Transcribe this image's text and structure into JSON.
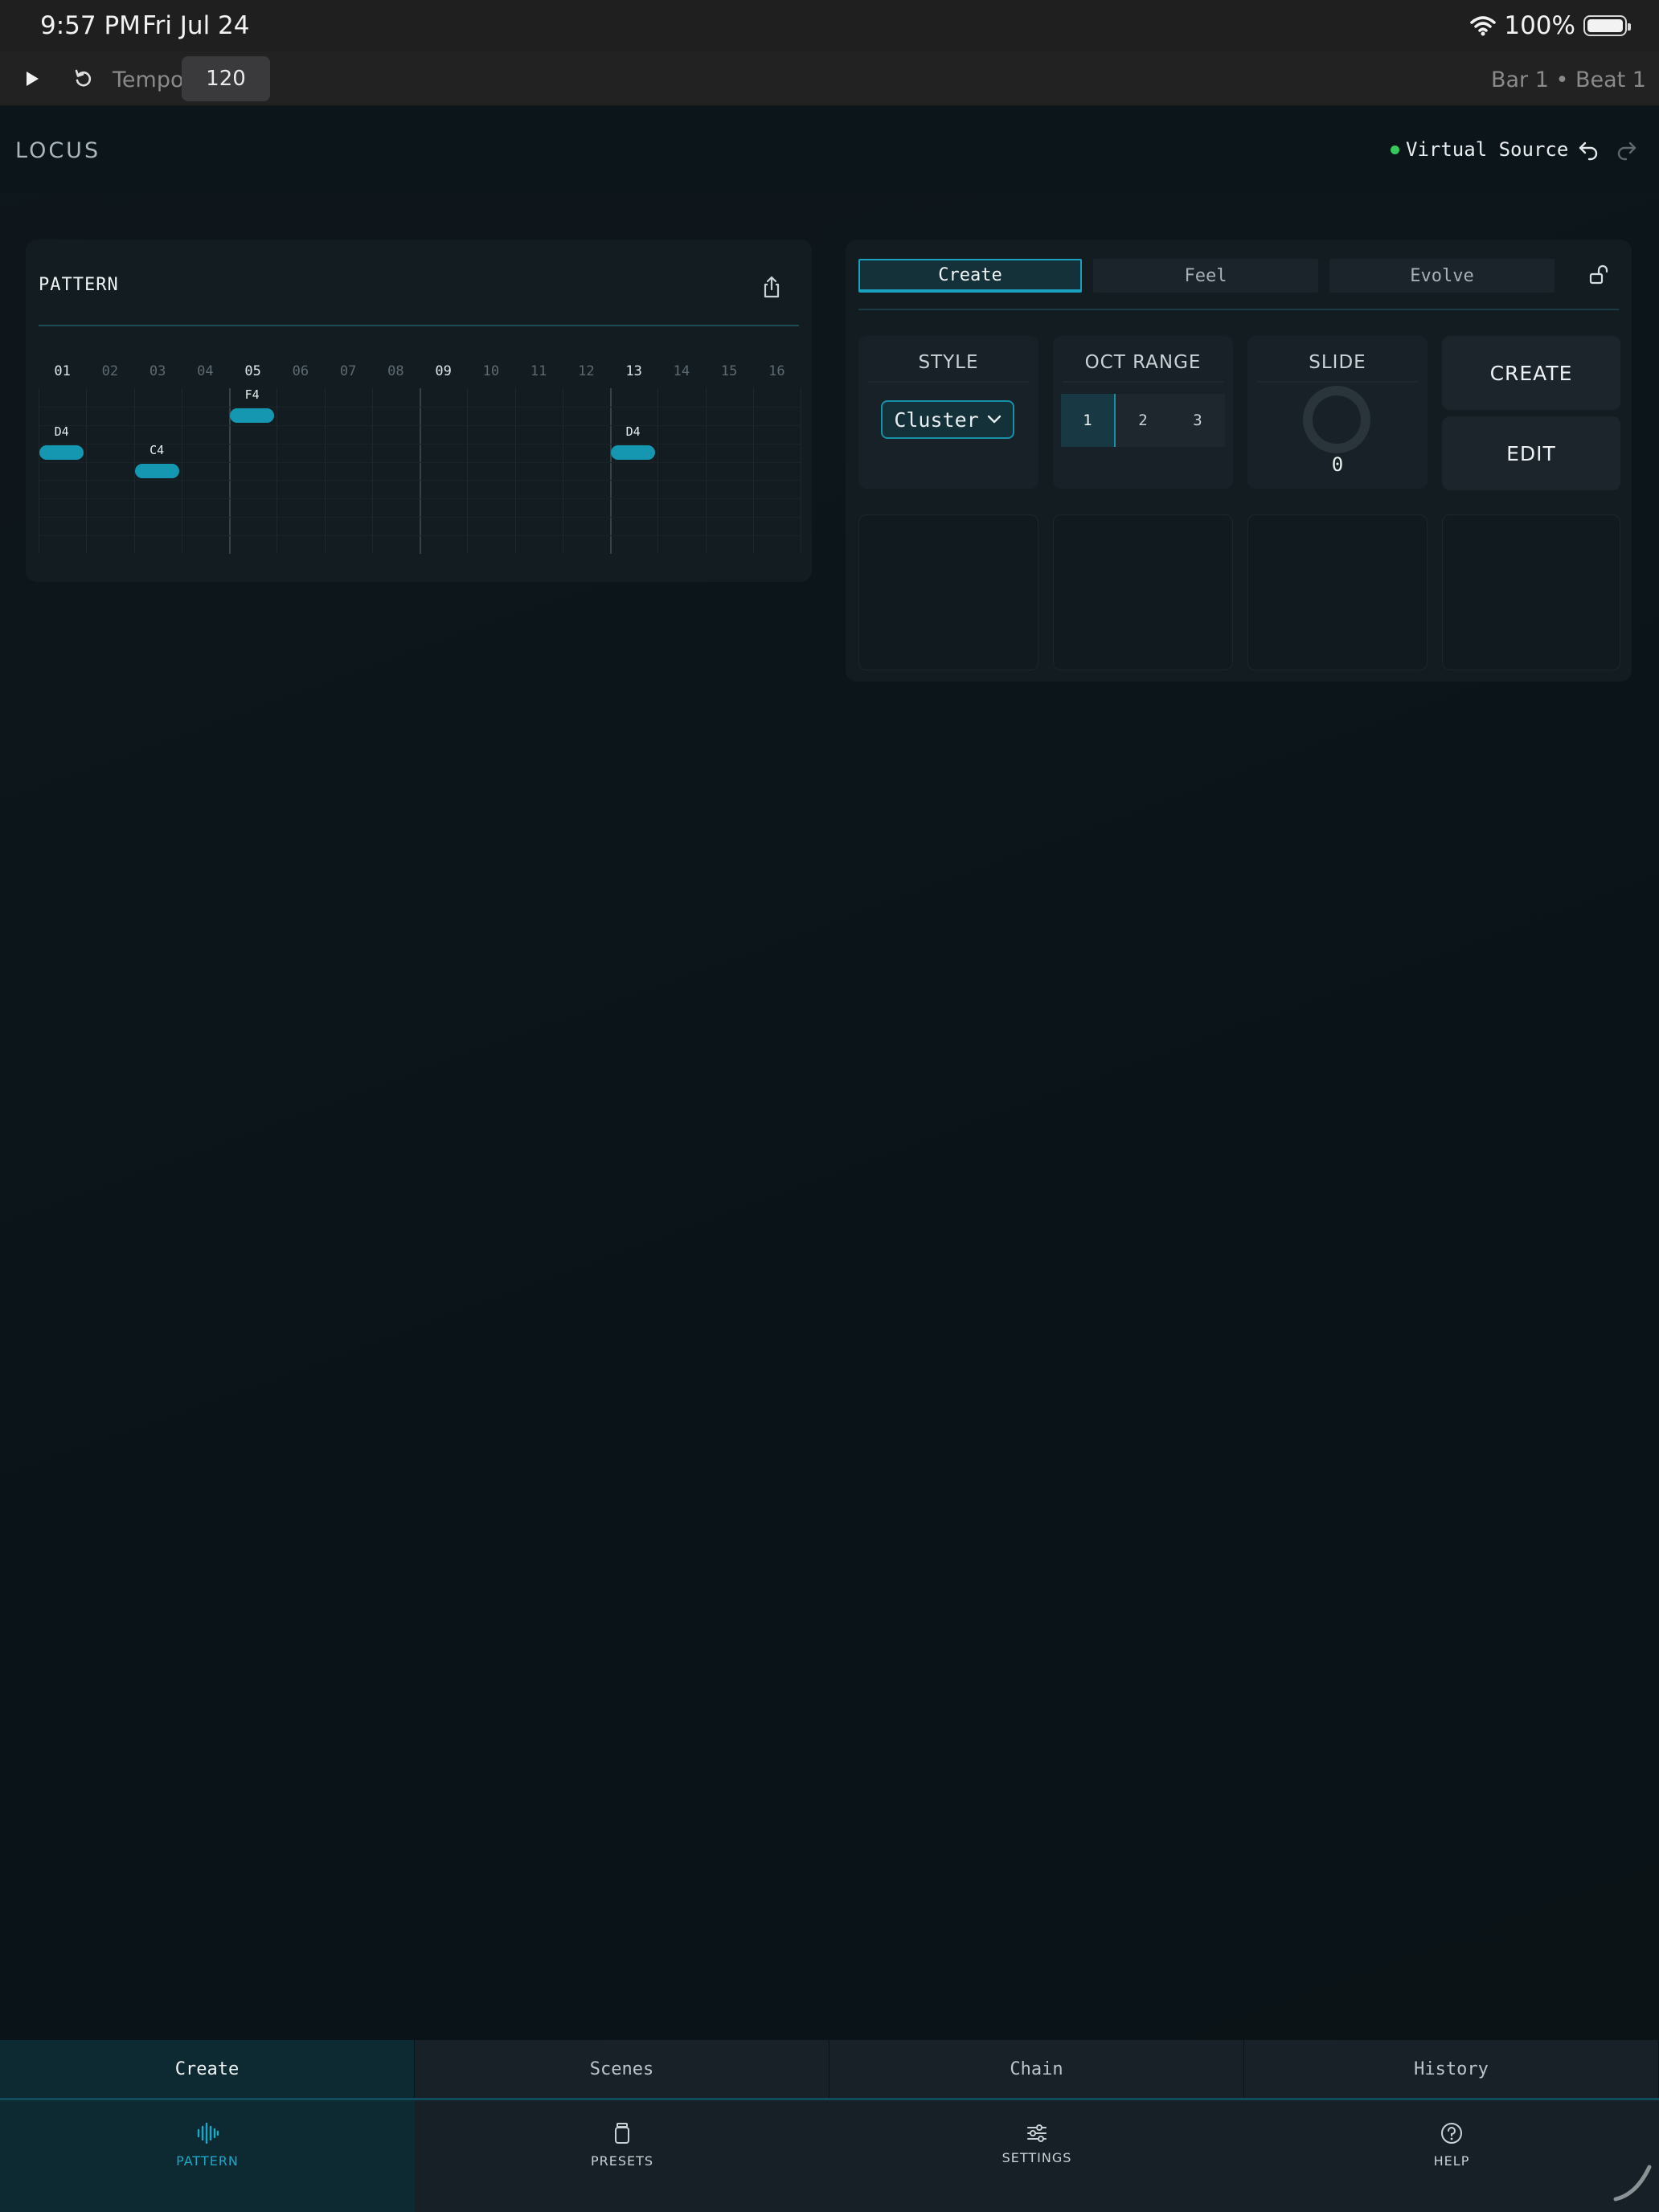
{
  "status_bar": {
    "time": "9:57 PM",
    "date": "Fri Jul 24",
    "battery": "100%"
  },
  "transport": {
    "tempo_label": "Tempo",
    "tempo_value": "120",
    "position": "Bar 1 • Beat 1"
  },
  "app": {
    "title": "LOCUS",
    "midi_source": "Virtual Source",
    "midi_status_color": "#35c85a"
  },
  "pattern": {
    "title": "PATTERN",
    "steps": [
      "01",
      "02",
      "03",
      "04",
      "05",
      "06",
      "07",
      "08",
      "09",
      "10",
      "11",
      "12",
      "13",
      "14",
      "15",
      "16"
    ],
    "notes": [
      {
        "label": "D4",
        "step": 1
      },
      {
        "label": "C4",
        "step": 3
      },
      {
        "label": "F4",
        "step": 5
      },
      {
        "label": "D4",
        "step": 13
      }
    ]
  },
  "controls": {
    "tabs": [
      {
        "label": "Create",
        "active": true
      },
      {
        "label": "Feel",
        "active": false
      },
      {
        "label": "Evolve",
        "active": false
      }
    ],
    "style": {
      "label": "STYLE",
      "value": "Cluster"
    },
    "oct_range": {
      "label": "OCT RANGE",
      "options": [
        "1",
        "2",
        "3"
      ],
      "selected": "1"
    },
    "slide": {
      "label": "SLIDE",
      "value": "0"
    },
    "create_label": "CREATE",
    "edit_label": "EDIT"
  },
  "sub_tabs": [
    {
      "label": "Create",
      "active": true
    },
    {
      "label": "Scenes",
      "active": false
    },
    {
      "label": "Chain",
      "active": false
    },
    {
      "label": "History",
      "active": false
    }
  ],
  "nav": [
    {
      "label": "PATTERN",
      "icon": "waveform-icon",
      "active": true
    },
    {
      "label": "PRESETS",
      "icon": "jar-icon",
      "active": false
    },
    {
      "label": "SETTINGS",
      "icon": "sliders-icon",
      "active": false
    },
    {
      "label": "HELP",
      "icon": "question-circle-icon",
      "active": false
    }
  ],
  "accent_color": "#1ba0c0"
}
